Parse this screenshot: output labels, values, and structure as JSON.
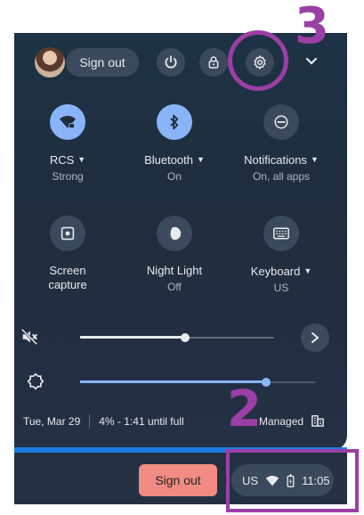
{
  "top_bar": {
    "sign_out_label": "Sign out",
    "icons": [
      "avatar",
      "power-icon",
      "lock-icon",
      "settings-gear-icon",
      "chevron-down-icon"
    ]
  },
  "tiles_row1": [
    {
      "label": "RCS",
      "sub": "Strong",
      "icon": "wifi-locked-icon",
      "active": true,
      "has_menu": true
    },
    {
      "label": "Bluetooth",
      "sub": "On",
      "icon": "bluetooth-icon",
      "active": true,
      "has_menu": true
    },
    {
      "label": "Notifications",
      "sub": "On, all apps",
      "icon": "notifications-icon",
      "active": false,
      "has_menu": true
    }
  ],
  "tiles_row2": [
    {
      "label": "Screen",
      "label2": "capture",
      "sub": "",
      "icon": "screen-capture-icon",
      "active": false,
      "has_menu": false
    },
    {
      "label": "Night Light",
      "sub": "Off",
      "icon": "night-light-icon",
      "active": false,
      "has_menu": false
    },
    {
      "label": "Keyboard",
      "sub": "US",
      "icon": "keyboard-icon",
      "active": false,
      "has_menu": true
    }
  ],
  "sliders": {
    "volume": {
      "icon": "volume-muted-icon",
      "level": 0.54
    },
    "brightness": {
      "icon": "brightness-icon",
      "level": 0.79
    }
  },
  "footer": {
    "date": "Tue, Mar 29",
    "battery": "4% - 1:41 until full",
    "managed": "Managed"
  },
  "shelf": {
    "sign_out_label": "Sign out",
    "status_locale": "US",
    "status_time": "11:05"
  },
  "annotations": {
    "label_3": "3",
    "label_2": "2",
    "color": "#9b3fa6"
  },
  "colors": {
    "active_tile": "#8ab4f8",
    "panel": "#1f2d3d",
    "shelf_signout": "#f28b82",
    "slider_active": "#8ab4f8"
  }
}
